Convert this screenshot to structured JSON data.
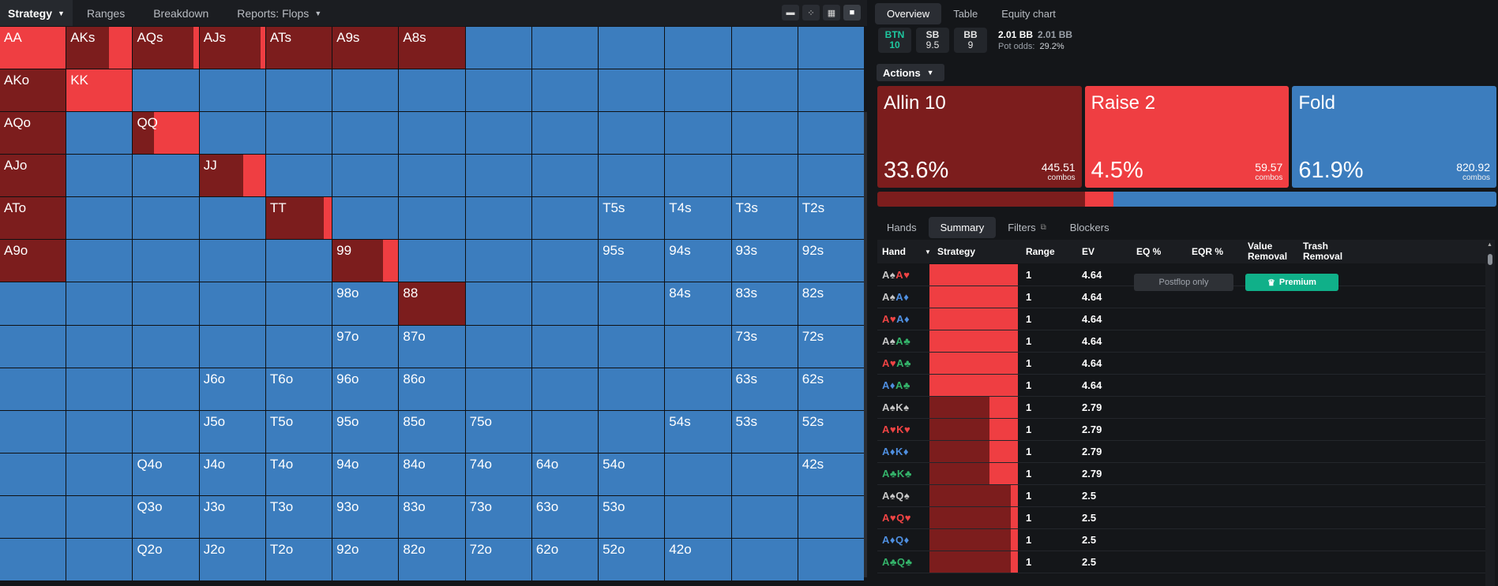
{
  "colors": {
    "allin": "#7c1d1d",
    "raise": "#ef3e42",
    "fold": "#3c7dbe"
  },
  "left_tabs": [
    {
      "label": "Strategy",
      "active": true,
      "caret": true
    },
    {
      "label": "Ranges"
    },
    {
      "label": "Breakdown"
    },
    {
      "label": "Reports: Flops",
      "caret": true
    }
  ],
  "view_icons": [
    "single-view-icon",
    "split-view-icon",
    "grid-view-icon",
    "full-view-icon"
  ],
  "matrix_labels": [
    [
      "AA",
      "AKs",
      "AQs",
      "AJs",
      "ATs",
      "A9s",
      "A8s",
      "",
      "",
      "",
      "",
      "",
      ""
    ],
    [
      "AKo",
      "KK",
      "",
      "",
      "",
      "",
      "",
      "",
      "",
      "",
      "",
      "",
      ""
    ],
    [
      "AQo",
      "",
      "QQ",
      "",
      "",
      "",
      "",
      "",
      "",
      "",
      "",
      "",
      ""
    ],
    [
      "AJo",
      "",
      "",
      "JJ",
      "",
      "",
      "",
      "",
      "",
      "",
      "",
      "",
      ""
    ],
    [
      "ATo",
      "",
      "",
      "",
      "TT",
      "",
      "",
      "",
      "",
      "T5s",
      "T4s",
      "T3s",
      "T2s"
    ],
    [
      "A9o",
      "",
      "",
      "",
      "",
      "99",
      "",
      "",
      "",
      "95s",
      "94s",
      "93s",
      "92s"
    ],
    [
      "",
      "",
      "",
      "",
      "",
      "98o",
      "88",
      "",
      "",
      "",
      "84s",
      "83s",
      "82s"
    ],
    [
      "",
      "",
      "",
      "",
      "",
      "97o",
      "87o",
      "",
      "",
      "",
      "",
      "73s",
      "72s"
    ],
    [
      "",
      "",
      "",
      "J6o",
      "T6o",
      "96o",
      "86o",
      "",
      "",
      "",
      "",
      "63s",
      "62s"
    ],
    [
      "",
      "",
      "",
      "J5o",
      "T5o",
      "95o",
      "85o",
      "75o",
      "",
      "",
      "54s",
      "53s",
      "52s"
    ],
    [
      "",
      "",
      "Q4o",
      "J4o",
      "T4o",
      "94o",
      "84o",
      "74o",
      "64o",
      "54o",
      "",
      "",
      "42s"
    ],
    [
      "",
      "",
      "Q3o",
      "J3o",
      "T3o",
      "93o",
      "83o",
      "73o",
      "63o",
      "53o",
      "",
      "",
      ""
    ],
    [
      "",
      "",
      "Q2o",
      "J2o",
      "T2o",
      "92o",
      "82o",
      "72o",
      "62o",
      "52o",
      "42o",
      "",
      ""
    ]
  ],
  "matrix_mix": {
    "0-0": [
      0.0,
      1.0
    ],
    "0-1": [
      0.65,
      0.35
    ],
    "0-2": [
      0.92,
      0.08
    ],
    "0-3": [
      0.93,
      0.07
    ],
    "0-4": [
      1.0,
      0.0
    ],
    "0-5": [
      1.0,
      0.0
    ],
    "0-6": [
      1.0,
      0.0
    ],
    "1-0": [
      1.0,
      0.0
    ],
    "1-1": [
      0.0,
      1.0
    ],
    "2-0": [
      1.0,
      0.0
    ],
    "2-2": [
      0.32,
      0.68
    ],
    "3-0": [
      1.0,
      0.0
    ],
    "3-3": [
      0.67,
      0.33
    ],
    "4-0": [
      1.0,
      0.0
    ],
    "4-4": [
      0.88,
      0.12
    ],
    "5-0": [
      1.0,
      0.0
    ],
    "5-5": [
      0.77,
      0.23
    ],
    "6-6": [
      1.0,
      0.0
    ]
  },
  "right_tabs": [
    {
      "label": "Overview",
      "active": true
    },
    {
      "label": "Table"
    },
    {
      "label": "Equity chart"
    }
  ],
  "positions": [
    {
      "name": "BTN",
      "stack": "10"
    },
    {
      "name": "SB",
      "stack": "9.5"
    },
    {
      "name": "BB",
      "stack": "9"
    }
  ],
  "pot": {
    "main": "2.01 BB",
    "secondary": "2.01 BB",
    "odds_label": "Pot odds:",
    "odds_value": "29.2%"
  },
  "actions_label": "Actions",
  "action_cards": [
    {
      "name": "Allin 10",
      "pct": "33.6%",
      "combos": "445.51",
      "combos_label": "combos",
      "color": "#7c1d1d",
      "share": 0.336
    },
    {
      "name": "Raise 2",
      "pct": "4.5%",
      "combos": "59.57",
      "combos_label": "combos",
      "color": "#ef3e42",
      "share": 0.045
    },
    {
      "name": "Fold",
      "pct": "61.9%",
      "combos": "820.92",
      "combos_label": "combos",
      "color": "#3c7dbe",
      "share": 0.619
    }
  ],
  "sub_tabs": [
    {
      "label": "Hands"
    },
    {
      "label": "Summary",
      "active": true
    },
    {
      "label": "Filters"
    },
    {
      "label": "Blockers"
    }
  ],
  "table_headers": {
    "hand": "Hand",
    "strategy": "Strategy",
    "range": "Range",
    "ev": "EV",
    "eq": "EQ %",
    "eqr": "EQR %",
    "value_removal": "Value Removal",
    "trash_removal": "Trash Removal"
  },
  "buttons": {
    "postflop": "Postflop only",
    "premium": "Premium"
  },
  "rows": [
    {
      "cards": [
        [
          "A",
          "s"
        ],
        [
          "A",
          "h"
        ]
      ],
      "range": "1",
      "ev": "4.64",
      "allin": 0.0,
      "raise": 1.0
    },
    {
      "cards": [
        [
          "A",
          "s"
        ],
        [
          "A",
          "d"
        ]
      ],
      "range": "1",
      "ev": "4.64",
      "allin": 0.0,
      "raise": 1.0
    },
    {
      "cards": [
        [
          "A",
          "h"
        ],
        [
          "A",
          "d"
        ]
      ],
      "range": "1",
      "ev": "4.64",
      "allin": 0.0,
      "raise": 1.0
    },
    {
      "cards": [
        [
          "A",
          "s"
        ],
        [
          "A",
          "c"
        ]
      ],
      "range": "1",
      "ev": "4.64",
      "allin": 0.0,
      "raise": 1.0
    },
    {
      "cards": [
        [
          "A",
          "h"
        ],
        [
          "A",
          "c"
        ]
      ],
      "range": "1",
      "ev": "4.64",
      "allin": 0.0,
      "raise": 1.0
    },
    {
      "cards": [
        [
          "A",
          "d"
        ],
        [
          "A",
          "c"
        ]
      ],
      "range": "1",
      "ev": "4.64",
      "allin": 0.0,
      "raise": 1.0
    },
    {
      "cards": [
        [
          "A",
          "s"
        ],
        [
          "K",
          "s"
        ]
      ],
      "range": "1",
      "ev": "2.79",
      "allin": 0.68,
      "raise": 0.32
    },
    {
      "cards": [
        [
          "A",
          "h"
        ],
        [
          "K",
          "h"
        ]
      ],
      "range": "1",
      "ev": "2.79",
      "allin": 0.68,
      "raise": 0.32
    },
    {
      "cards": [
        [
          "A",
          "d"
        ],
        [
          "K",
          "d"
        ]
      ],
      "range": "1",
      "ev": "2.79",
      "allin": 0.68,
      "raise": 0.32
    },
    {
      "cards": [
        [
          "A",
          "c"
        ],
        [
          "K",
          "c"
        ]
      ],
      "range": "1",
      "ev": "2.79",
      "allin": 0.68,
      "raise": 0.32
    },
    {
      "cards": [
        [
          "A",
          "s"
        ],
        [
          "Q",
          "s"
        ]
      ],
      "range": "1",
      "ev": "2.5",
      "allin": 0.92,
      "raise": 0.08
    },
    {
      "cards": [
        [
          "A",
          "h"
        ],
        [
          "Q",
          "h"
        ]
      ],
      "range": "1",
      "ev": "2.5",
      "allin": 0.92,
      "raise": 0.08
    },
    {
      "cards": [
        [
          "A",
          "d"
        ],
        [
          "Q",
          "d"
        ]
      ],
      "range": "1",
      "ev": "2.5",
      "allin": 0.92,
      "raise": 0.08
    },
    {
      "cards": [
        [
          "A",
          "c"
        ],
        [
          "Q",
          "c"
        ]
      ],
      "range": "1",
      "ev": "2.5",
      "allin": 0.92,
      "raise": 0.08
    }
  ],
  "suit_glyphs": {
    "s": "♠",
    "h": "♥",
    "d": "♦",
    "c": "♣"
  }
}
